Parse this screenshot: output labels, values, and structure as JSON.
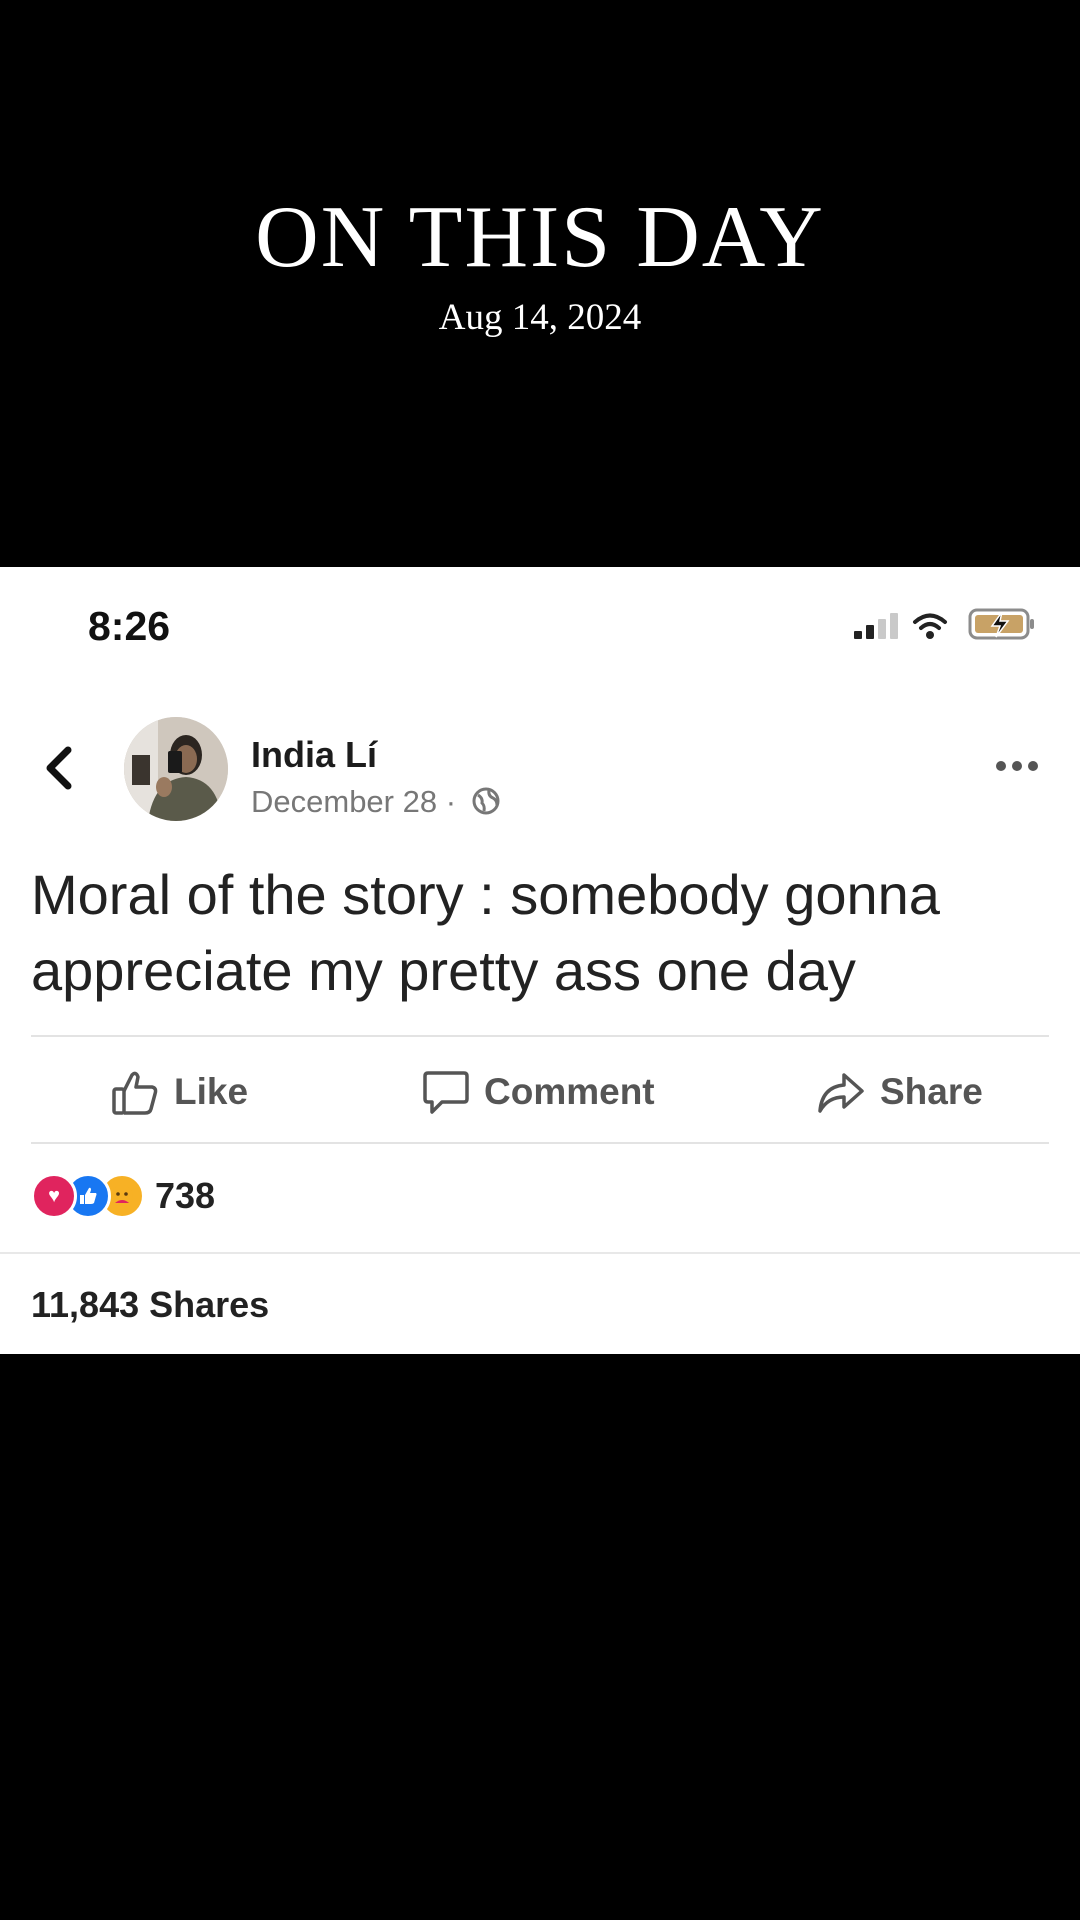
{
  "header": {
    "title": "ON THIS DAY",
    "date": "Aug 14, 2024"
  },
  "status_bar": {
    "time": "8:26",
    "icons": [
      "cellular-signal-icon",
      "wifi-icon",
      "battery-charging-icon"
    ]
  },
  "post": {
    "author": "India Lí",
    "date": "December 28 ·",
    "text_line1": "Moral of the story : somebody gonna",
    "text_line2": "appreciate my pretty ass one day",
    "actions": {
      "like": "Like",
      "comment": "Comment",
      "share": "Share"
    },
    "reactions": {
      "icons": [
        "love-icon",
        "like-icon",
        "care-icon"
      ],
      "count": "738"
    },
    "shares": "11,843 Shares"
  },
  "colors": {
    "background": "#000000",
    "card": "#ffffff",
    "love": "#e0245e",
    "like": "#1877f2",
    "care": "#f7b125"
  }
}
